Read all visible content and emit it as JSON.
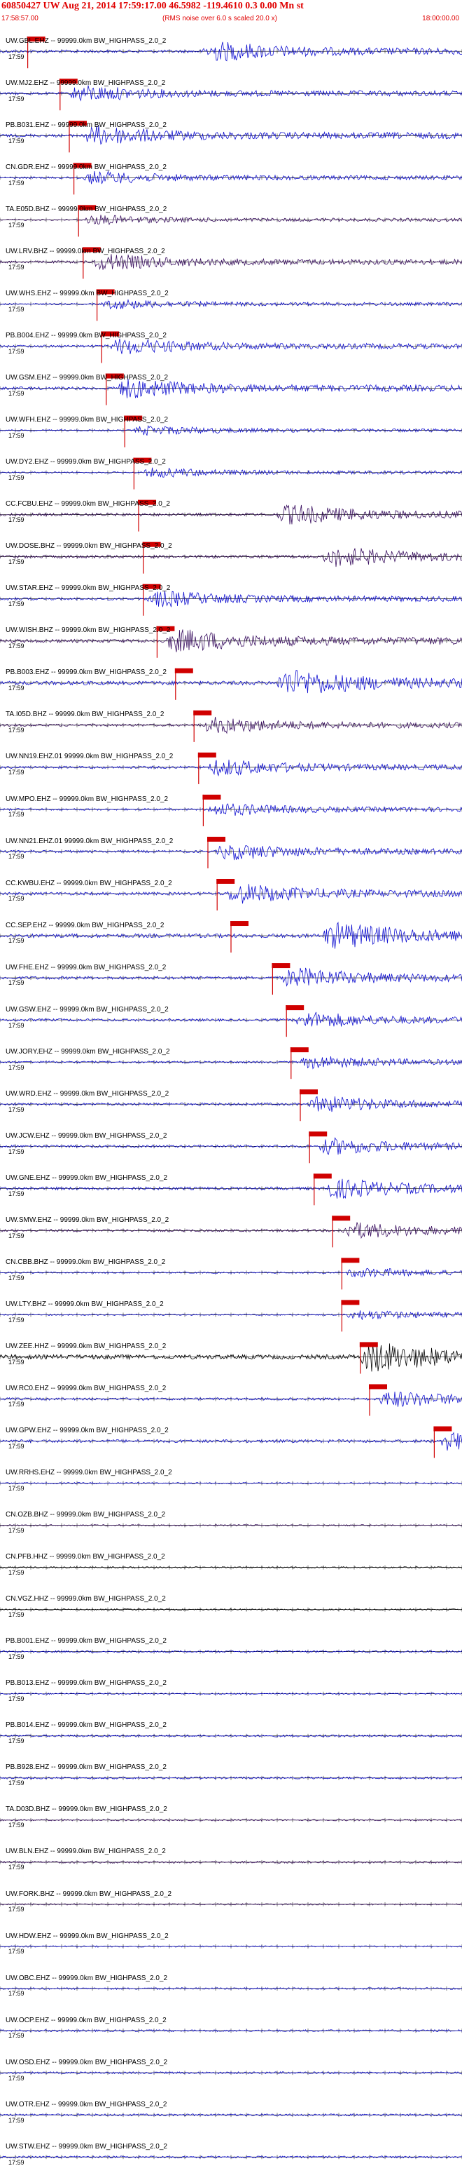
{
  "header": {
    "title": "60850427 UW Aug 21, 2014 17:59:17.00   46.5982 -119.4610  0.3 0.00 Mn st",
    "left_time": "17:58:57.00",
    "scale_note": "(RMS noise over 6.0 s scaled 20.0 x)",
    "right_time": "18:00:00.00"
  },
  "colors": {
    "blue": "#1010d0",
    "purple": "#3a1060",
    "black": "#000000",
    "red": "#d00000"
  },
  "trace_time_label": "17:59",
  "channels": [
    {
      "label": "UW.GBL.EHZ -- 99999.0km BW_HIGHPASS_2.0_2",
      "color": "blue",
      "pick": 0.06,
      "burst": 0.44,
      "amp": 0.6
    },
    {
      "label": "UW.MJ2.EHZ -- 99999.0km BW_HIGHPASS_2.0_2",
      "color": "blue",
      "pick": 0.13,
      "burst": 0.15,
      "amp": 0.5
    },
    {
      "label": "PB.B031.EHZ -- 99999.0km BW_HIGHPASS_2.0_2",
      "color": "blue",
      "pick": 0.15,
      "burst": 0.18,
      "amp": 0.6
    },
    {
      "label": "CN.GDR.EHZ -- 99999.0km BW_HIGHPASS_2.0_2",
      "color": "blue",
      "pick": 0.16,
      "burst": 0.18,
      "amp": 0.4
    },
    {
      "label": "TA.E05D.BHZ -- 99999.0km BW_HIGHPASS_2.0_2",
      "color": "purple",
      "pick": 0.17,
      "burst": 0.18,
      "amp": 0.3
    },
    {
      "label": "UW.LRV.BHZ -- 99999.0km BW_HIGHPASS_2.0_2",
      "color": "purple",
      "pick": 0.18,
      "burst": 0.2,
      "amp": 0.5
    },
    {
      "label": "UW.WHS.EHZ -- 99999.0km BW_HIGHPASS_2.0_2",
      "color": "blue",
      "pick": 0.21,
      "burst": 0.22,
      "amp": 0.3
    },
    {
      "label": "PB.B004.EHZ -- 99999.0km BW_HIGHPASS_2.0_2",
      "color": "blue",
      "pick": 0.22,
      "burst": 0.24,
      "amp": 0.5
    },
    {
      "label": "UW.GSM.EHZ -- 99999.0km BW_HIGHPASS_2.0_2",
      "color": "blue",
      "pick": 0.23,
      "burst": 0.25,
      "amp": 0.6
    },
    {
      "label": "UW.WFH.EHZ -- 99999.0km BW_HIGHPASS_2.0_2",
      "color": "blue",
      "pick": 0.27,
      "burst": 0.29,
      "amp": 0.3
    },
    {
      "label": "UW.DY2.EHZ -- 99999.0km BW_HIGHPASS_2.0_2",
      "color": "blue",
      "pick": 0.29,
      "burst": 0.31,
      "amp": 0.3
    },
    {
      "label": "CC.FCBU.EHZ -- 99999.0km BW_HIGHPASS_2.0_2",
      "color": "purple",
      "pick": 0.3,
      "burst": 0.6,
      "amp": 0.6
    },
    {
      "label": "UW.DOSE.BHZ -- 99999.0km BW_HIGHPASS_2.0_2",
      "color": "purple",
      "pick": 0.31,
      "burst": 0.7,
      "amp": 0.6
    },
    {
      "label": "UW.STAR.EHZ -- 99999.0km BW_HIGHPASS_2.0_2",
      "color": "blue",
      "pick": 0.31,
      "burst": 0.32,
      "amp": 0.5
    },
    {
      "label": "UW.WISH.BHZ -- 99999.0km BW_HIGHPASS_2.0_2",
      "color": "purple",
      "pick": 0.34,
      "burst": 0.36,
      "amp": 0.7
    },
    {
      "label": "PB.B003.EHZ -- 99999.0km BW_HIGHPASS_2.0_2",
      "color": "blue",
      "pick": 0.38,
      "burst": 0.6,
      "amp": 0.8
    },
    {
      "label": "TA.I05D.BHZ -- 99999.0km BW_HIGHPASS_2.0_2",
      "color": "purple",
      "pick": 0.42,
      "burst": 0.44,
      "amp": 0.5
    },
    {
      "label": "UW.NN19.EHZ.01 99999.0km BW_HIGHPASS_2.0_2",
      "color": "blue",
      "pick": 0.43,
      "burst": 0.45,
      "amp": 0.5
    },
    {
      "label": "UW.MPO.EHZ -- 99999.0km BW_HIGHPASS_2.0_2",
      "color": "blue",
      "pick": 0.44,
      "burst": 0.45,
      "amp": 0.4
    },
    {
      "label": "UW.NN21.EHZ.01 99999.0km BW_HIGHPASS_2.0_2",
      "color": "blue",
      "pick": 0.45,
      "burst": 0.47,
      "amp": 0.5
    },
    {
      "label": "CC.KWBU.EHZ -- 99999.0km BW_HIGHPASS_2.0_2",
      "color": "blue",
      "pick": 0.47,
      "burst": 0.49,
      "amp": 0.6
    },
    {
      "label": "CC.SEP.EHZ -- 99999.0km BW_HIGHPASS_2.0_2",
      "color": "blue",
      "pick": 0.5,
      "burst": 0.7,
      "amp": 0.8
    },
    {
      "label": "UW.FHE.EHZ -- 99999.0km BW_HIGHPASS_2.0_2",
      "color": "blue",
      "pick": 0.59,
      "burst": 0.61,
      "amp": 0.6
    },
    {
      "label": "UW.GSW.EHZ -- 99999.0km BW_HIGHPASS_2.0_2",
      "color": "blue",
      "pick": 0.62,
      "burst": 0.64,
      "amp": 0.5
    },
    {
      "label": "UW.JORY.EHZ -- 99999.0km BW_HIGHPASS_2.0_2",
      "color": "blue",
      "pick": 0.63,
      "burst": 0.65,
      "amp": 0.4
    },
    {
      "label": "UW.WRD.EHZ -- 99999.0km BW_HIGHPASS_2.0_2",
      "color": "blue",
      "pick": 0.65,
      "burst": 0.67,
      "amp": 0.5
    },
    {
      "label": "UW.JCW.EHZ -- 99999.0km BW_HIGHPASS_2.0_2",
      "color": "blue",
      "pick": 0.67,
      "burst": 0.69,
      "amp": 0.5
    },
    {
      "label": "UW.GNE.EHZ -- 99999.0km BW_HIGHPASS_2.0_2",
      "color": "blue",
      "pick": 0.68,
      "burst": 0.7,
      "amp": 0.6
    },
    {
      "label": "UW.SMW.EHZ -- 99999.0km BW_HIGHPASS_2.0_2",
      "color": "purple",
      "pick": 0.72,
      "burst": 0.74,
      "amp": 0.5
    },
    {
      "label": "CN.CBB.BHZ -- 99999.0km BW_HIGHPASS_2.0_2",
      "color": "blue",
      "pick": 0.74,
      "burst": 0.75,
      "amp": 0.3
    },
    {
      "label": "UW.LTY.BHZ -- 99999.0km BW_HIGHPASS_2.0_2",
      "color": "blue",
      "pick": 0.74,
      "burst": 0.75,
      "amp": 0.3
    },
    {
      "label": "UW.ZEE.HHZ -- 99999.0km BW_HIGHPASS_2.0_2",
      "color": "black",
      "pick": 0.78,
      "burst": 0.78,
      "amp": 0.9
    },
    {
      "label": "UW.RC0.EHZ -- 99999.0km BW_HIGHPASS_2.0_2",
      "color": "blue",
      "pick": 0.8,
      "burst": 0.82,
      "amp": 0.5
    },
    {
      "label": "UW.GPW.EHZ -- 99999.0km BW_HIGHPASS_2.0_2",
      "color": "blue",
      "pick": 0.94,
      "burst": 0.95,
      "amp": 0.6
    },
    {
      "label": "UW.RRHS.EHZ -- 99999.0km BW_HIGHPASS_2.0_2",
      "color": "blue",
      "pick": null,
      "burst": null,
      "amp": 0.3
    },
    {
      "label": "CN.OZB.BHZ -- 99999.0km BW_HIGHPASS_2.0_2",
      "color": "purple",
      "pick": null,
      "burst": null,
      "amp": 0.3
    },
    {
      "label": "CN.PFB.HHZ -- 99999.0km BW_HIGHPASS_2.0_2",
      "color": "black",
      "pick": null,
      "burst": null,
      "amp": 0.3
    },
    {
      "label": "CN.VGZ.HHZ -- 99999.0km BW_HIGHPASS_2.0_2",
      "color": "black",
      "pick": null,
      "burst": null,
      "amp": 0.3
    },
    {
      "label": "PB.B001.EHZ -- 99999.0km BW_HIGHPASS_2.0_2",
      "color": "blue",
      "pick": null,
      "burst": null,
      "amp": 0.4
    },
    {
      "label": "PB.B013.EHZ -- 99999.0km BW_HIGHPASS_2.0_2",
      "color": "blue",
      "pick": null,
      "burst": null,
      "amp": 0.3
    },
    {
      "label": "PB.B014.EHZ -- 99999.0km BW_HIGHPASS_2.0_2",
      "color": "blue",
      "pick": null,
      "burst": null,
      "amp": 0.4
    },
    {
      "label": "PB.B928.EHZ -- 99999.0km BW_HIGHPASS_2.0_2",
      "color": "blue",
      "pick": null,
      "burst": null,
      "amp": 0.4
    },
    {
      "label": "TA.D03D.BHZ -- 99999.0km BW_HIGHPASS_2.0_2",
      "color": "purple",
      "pick": null,
      "burst": null,
      "amp": 0.3
    },
    {
      "label": "UW.BLN.EHZ -- 99999.0km BW_HIGHPASS_2.0_2",
      "color": "purple",
      "pick": null,
      "burst": null,
      "amp": 0.4
    },
    {
      "label": "UW.FORK.BHZ -- 99999.0km BW_HIGHPASS_2.0_2",
      "color": "purple",
      "pick": null,
      "burst": null,
      "amp": 0.3
    },
    {
      "label": "UW.HDW.EHZ -- 99999.0km BW_HIGHPASS_2.0_2",
      "color": "blue",
      "pick": null,
      "burst": null,
      "amp": 0.3
    },
    {
      "label": "UW.OBC.EHZ -- 99999.0km BW_HIGHPASS_2.0_2",
      "color": "blue",
      "pick": null,
      "burst": null,
      "amp": 0.4
    },
    {
      "label": "UW.OCP.EHZ -- 99999.0km BW_HIGHPASS_2.0_2",
      "color": "blue",
      "pick": null,
      "burst": null,
      "amp": 0.4
    },
    {
      "label": "UW.OSD.EHZ -- 99999.0km BW_HIGHPASS_2.0_2",
      "color": "blue",
      "pick": null,
      "burst": null,
      "amp": 0.4
    },
    {
      "label": "UW.OTR.EHZ -- 99999.0km BW_HIGHPASS_2.0_2",
      "color": "blue",
      "pick": null,
      "burst": null,
      "amp": 0.4
    },
    {
      "label": "UW.STW.EHZ -- 99999.0km BW_HIGHPASS_2.0_2",
      "color": "blue",
      "pick": null,
      "burst": null,
      "amp": 0.4
    }
  ]
}
